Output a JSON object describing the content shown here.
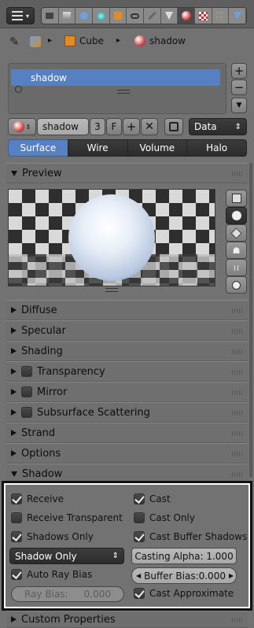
{
  "header": {
    "tabs": [
      "render-icon",
      "layers-icon",
      "scene-icon",
      "world-icon",
      "object-icon",
      "constraints-icon",
      "modifiers-icon",
      "data-icon",
      "material-icon",
      "texture-icon",
      "particles-icon",
      "physics-icon"
    ]
  },
  "breadcrumb": {
    "items": [
      "Cube",
      "shadow"
    ]
  },
  "slots": {
    "items": [
      "shadow"
    ]
  },
  "datablock": {
    "name": "shadow",
    "users": "3",
    "fake_user": "F",
    "link": "Data"
  },
  "type_tabs": [
    "Surface",
    "Wire",
    "Volume",
    "Halo"
  ],
  "panels": {
    "preview": "Preview",
    "diffuse": "Diffuse",
    "specular": "Specular",
    "shading": "Shading",
    "transparency": "Transparency",
    "mirror": "Mirror",
    "sss": "Subsurface Scattering",
    "strand": "Strand",
    "options": "Options",
    "shadow": "Shadow",
    "custom": "Custom Properties"
  },
  "shadow": {
    "receive": {
      "label": "Receive",
      "checked": true
    },
    "receive_transparent": {
      "label": "Receive Transparent",
      "checked": false
    },
    "shadows_only": {
      "label": "Shadows Only",
      "checked": true
    },
    "shadow_mode": "Shadow Only",
    "auto_ray_bias": {
      "label": "Auto Ray Bias",
      "checked": true
    },
    "ray_bias": {
      "label": "Ray Bias:",
      "value": "0.000"
    },
    "cast": {
      "label": "Cast",
      "checked": true
    },
    "cast_only": {
      "label": "Cast Only",
      "checked": false
    },
    "cast_buffer_shadows": {
      "label": "Cast Buffer Shadows",
      "checked": true
    },
    "casting_alpha": "Casting Alpha: 1.000",
    "buffer_bias": {
      "label": "Buffer Bias:",
      "value": "0.000"
    },
    "cast_approximate": {
      "label": "Cast Approximate",
      "checked": true
    }
  },
  "colors": {
    "accent": "#5680c2",
    "highlight_frame": "#ffffff",
    "background": "#727272"
  }
}
